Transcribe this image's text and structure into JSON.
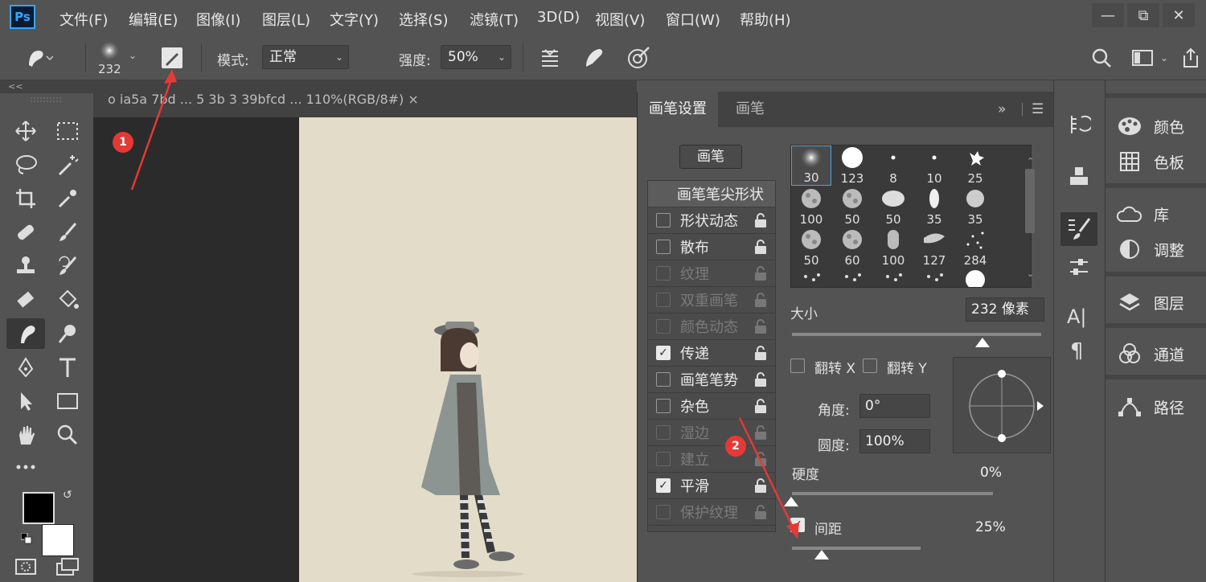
{
  "app": {
    "logo": "Ps"
  },
  "menu": [
    {
      "label": "文件(F)"
    },
    {
      "label": "编辑(E)"
    },
    {
      "label": "图像(I)"
    },
    {
      "label": "图层(L)"
    },
    {
      "label": "文字(Y)"
    },
    {
      "label": "选择(S)"
    },
    {
      "label": "滤镜(T)"
    },
    {
      "label": "3D(D)"
    },
    {
      "label": "视图(V)"
    },
    {
      "label": "窗口(W)"
    },
    {
      "label": "帮助(H)"
    }
  ],
  "options_bar": {
    "brush_size": "232",
    "mode_label": "模式:",
    "mode_value": "正常",
    "strength_label": "强度:",
    "strength_value": "50%"
  },
  "collapse_glyph": "<<",
  "document": {
    "tab_title": "o  ia5a  7bd  ...  5  3b  3  39bfcd  ...  110%(RGB/8#)  ×"
  },
  "brush_panel": {
    "tab_active": "画笔设置",
    "tab_other": "画笔",
    "presets_button": "画笔",
    "tip_shape_header": "画笔笔尖形状",
    "options": [
      {
        "label": "形状动态",
        "checked": false,
        "enabled": true
      },
      {
        "label": "散布",
        "checked": false,
        "enabled": true
      },
      {
        "label": "纹理",
        "checked": false,
        "enabled": false
      },
      {
        "label": "双重画笔",
        "checked": false,
        "enabled": false
      },
      {
        "label": "颜色动态",
        "checked": false,
        "enabled": false
      },
      {
        "label": "传递",
        "checked": true,
        "enabled": true
      },
      {
        "label": "画笔笔势",
        "checked": false,
        "enabled": true
      },
      {
        "label": "杂色",
        "checked": false,
        "enabled": true
      },
      {
        "label": "湿边",
        "checked": false,
        "enabled": false
      },
      {
        "label": "建立",
        "checked": false,
        "enabled": false
      },
      {
        "label": "平滑",
        "checked": true,
        "enabled": true
      },
      {
        "label": "保护纹理",
        "checked": false,
        "enabled": false
      }
    ],
    "tips": [
      {
        "size": "30"
      },
      {
        "size": "123"
      },
      {
        "size": "8"
      },
      {
        "size": "10"
      },
      {
        "size": "25"
      },
      {
        "size": "100"
      },
      {
        "size": "50"
      },
      {
        "size": "50"
      },
      {
        "size": "35"
      },
      {
        "size": "35"
      },
      {
        "size": "50"
      },
      {
        "size": "60"
      },
      {
        "size": "100"
      },
      {
        "size": "127"
      },
      {
        "size": "284"
      }
    ],
    "size_label": "大小",
    "size_value": "232 像素",
    "flip_x_label": "翻转 X",
    "flip_y_label": "翻转 Y",
    "angle_label": "角度:",
    "angle_value": "0°",
    "roundness_label": "圆度:",
    "roundness_value": "100%",
    "hardness_label": "硬度",
    "hardness_value": "0%",
    "spacing_label": "间距",
    "spacing_value": "25%",
    "spacing_checked": true
  },
  "dock": {
    "panels": [
      {
        "label": "颜色"
      },
      {
        "label": "色板"
      },
      {
        "label": "库"
      },
      {
        "label": "调整"
      },
      {
        "label": "图层"
      },
      {
        "label": "通道"
      },
      {
        "label": "路径"
      }
    ]
  },
  "annotations": {
    "badge1": "1",
    "badge2": "2"
  },
  "colors": {
    "accent": "#31a8ff",
    "annotation": "#e53935",
    "canvas": "#e3dcc8"
  }
}
